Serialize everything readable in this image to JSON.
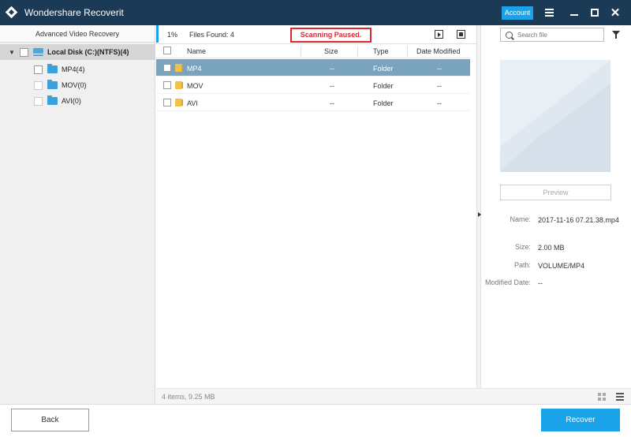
{
  "titlebar": {
    "title": "Wondershare Recoverit",
    "account_label": "Account"
  },
  "icons": {
    "app": "recoverit-logo-icon",
    "menu": "hamburger-menu-icon",
    "minimize": "minimize-icon",
    "maximize": "maximize-icon",
    "close": "close-icon",
    "search": "search-icon",
    "filter": "filter-icon",
    "play": "play-icon",
    "stop": "stop-icon",
    "disk": "hard-disk-icon",
    "folder": "folder-icon"
  },
  "colors": {
    "titlebar_bg": "#1a3a55",
    "accent": "#1aa3e8",
    "status_red": "#e0262f",
    "selected_row": "#7aa3bd"
  },
  "sidebar": {
    "header": "Advanced Video Recovery",
    "disk": {
      "label": "Local Disk (C:)(NTFS)(4)"
    },
    "folders": [
      {
        "label": "MP4(4)"
      },
      {
        "label": "MOV(0)"
      },
      {
        "label": "AVI(0)"
      }
    ]
  },
  "toolbar": {
    "percent": "1%",
    "files_found": "Files Found:  4",
    "scan_status": "Scanning Paused."
  },
  "search": {
    "placeholder": "Search file",
    "value": ""
  },
  "table": {
    "columns": [
      "Name",
      "Size",
      "Type",
      "Date Modified"
    ],
    "rows": [
      {
        "name": "MP4",
        "size": "--",
        "type": "Folder",
        "date": "--"
      },
      {
        "name": "MOV",
        "size": "--",
        "type": "Folder",
        "date": "--"
      },
      {
        "name": "AVI",
        "size": "--",
        "type": "Folder",
        "date": "--"
      }
    ]
  },
  "preview": {
    "button_label": "Preview",
    "name_label": "Name:",
    "name_value": "2017-11-16 07.21.38.mp4",
    "size_label": "Size:",
    "size_value": "2.00 MB",
    "path_label": "Path:",
    "path_value": "VOLUME/MP4",
    "modified_label": "Modified Date:",
    "modified_value": "--"
  },
  "status_bar": {
    "summary": "4 items, 9.25 MB"
  },
  "bottom": {
    "back_label": "Back",
    "recover_label": "Recover"
  }
}
